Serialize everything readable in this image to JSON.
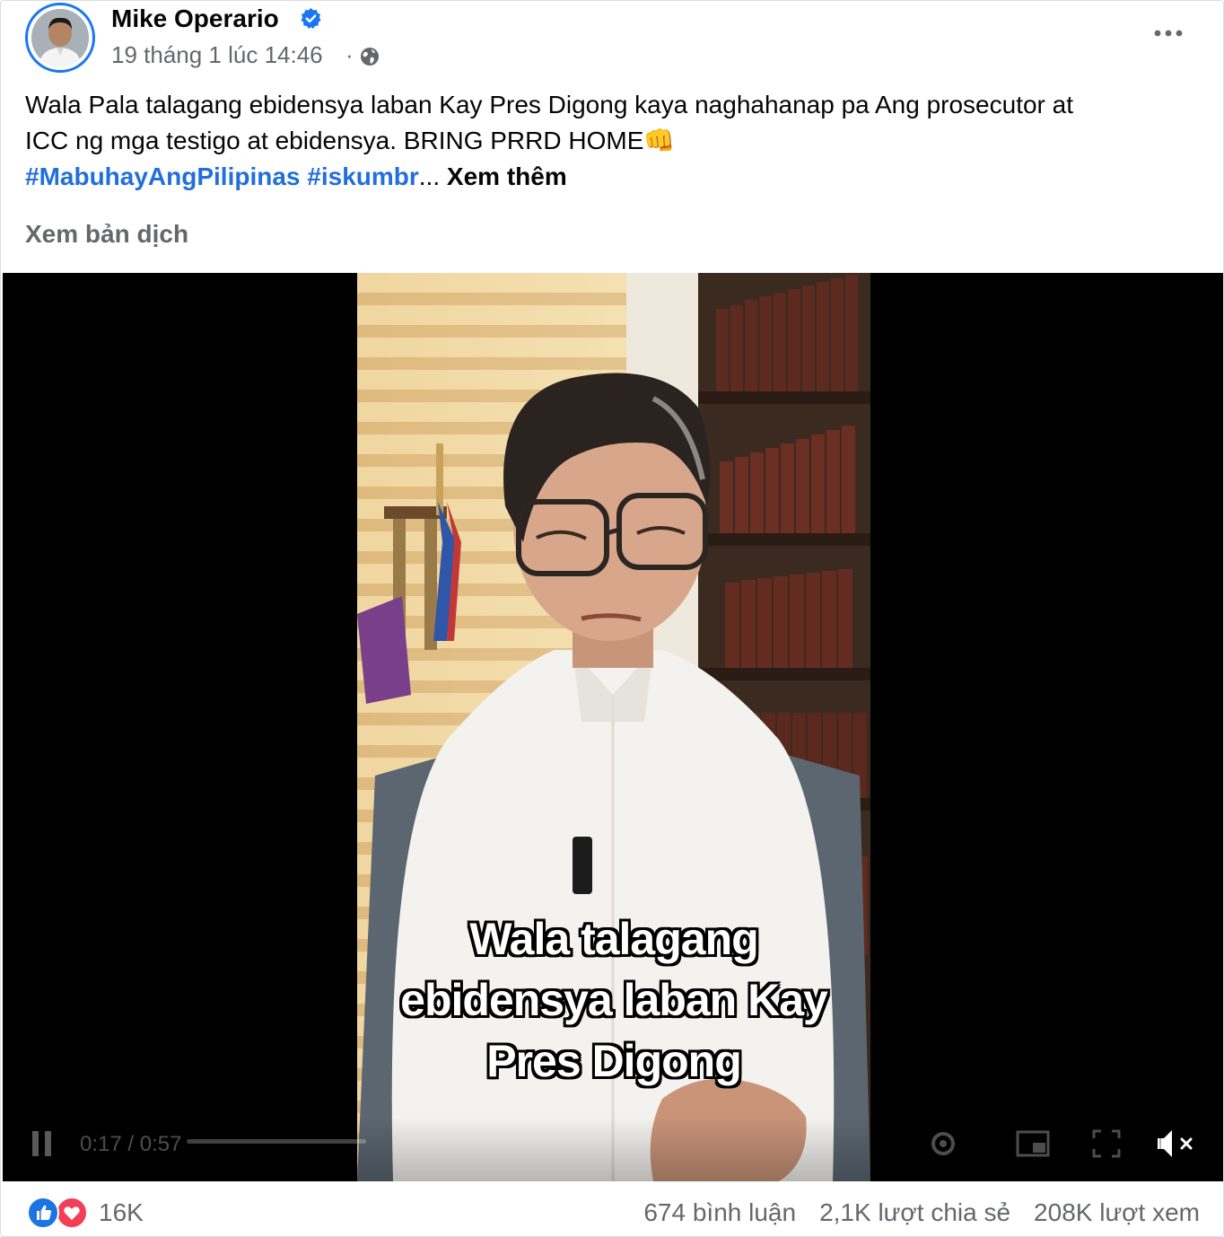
{
  "post": {
    "author": "Mike Operario",
    "timestamp": "19 tháng 1 lúc 14:46",
    "separator": "·",
    "text_line1": "Wala Pala talagang ebidensya laban Kay Pres Digong kaya naghahanap pa Ang prosecutor at",
    "text_line2": "ICC ng mga  testigo at ebidensya. BRING PRRD HOME👊",
    "hashtags": [
      "#MabuhayAngPilipinas",
      "#iskumbr"
    ],
    "ellipsis": "...",
    "see_more": "Xem thêm",
    "translate": "Xem bản dịch"
  },
  "video": {
    "subtitle_lines": [
      "Wala talagang",
      "ebidensya laban Kay",
      "Pres Digong"
    ],
    "time": "0:17 / 0:57",
    "muted": true
  },
  "footer": {
    "reaction_icons": [
      "like-icon",
      "love-icon"
    ],
    "reaction_count": "16K",
    "comments": "674 bình luận",
    "shares": "2,1K lượt chia sẻ",
    "views": "208K lượt xem"
  },
  "colors": {
    "brand": "#1877f2",
    "hashtag": "#216fdb",
    "secondary_text": "#65676b",
    "love": "#f33e58"
  }
}
